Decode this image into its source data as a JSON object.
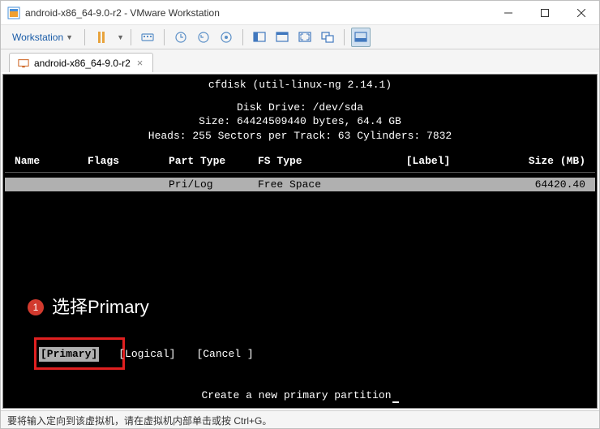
{
  "window": {
    "title": "android-x86_64-9.0-r2 - VMware Workstation"
  },
  "menu": {
    "workstation": "Workstation"
  },
  "tab": {
    "label": "android-x86_64-9.0-r2"
  },
  "console": {
    "line1": "cfdisk (util-linux-ng 2.14.1)",
    "line2": "Disk Drive: /dev/sda",
    "line3": "Size: 64424509440 bytes, 64.4 GB",
    "line4": "Heads: 255   Sectors per Track: 63   Cylinders: 7832",
    "headers": {
      "name": "Name",
      "flags": "Flags",
      "part_type": "Part Type",
      "fs_type": "FS Type",
      "label": "[Label]",
      "size": "Size (MB)"
    },
    "row": {
      "part_type": "Pri/Log",
      "fs_type": "Free Space",
      "size": "64420.40"
    },
    "options": {
      "primary": "[Primary]",
      "logical": "[Logical]",
      "cancel": "[Cancel ]"
    },
    "hint": "Create a new primary partition"
  },
  "annotation": {
    "num": "1",
    "text": "选择Primary"
  },
  "status": {
    "text": "要将输入定向到该虚拟机，请在虚拟机内部单击或按 Ctrl+G。"
  }
}
